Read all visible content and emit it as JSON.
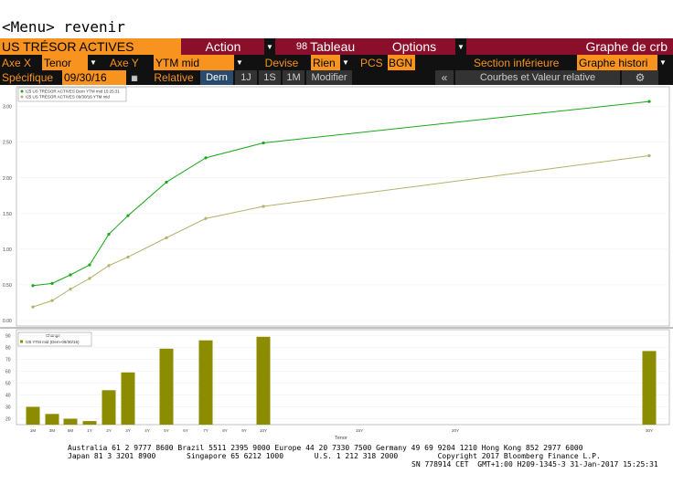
{
  "command": "<Menu> revenir",
  "toolbar": {
    "security": "US TRÉSOR ACTIVES",
    "action": "Action",
    "tableau_num": "98",
    "tableau": "Tableau",
    "options": "Options",
    "graph_title": "Graphe de crb"
  },
  "row2": {
    "axe_x_label": "Axe X",
    "axe_x_value": "Tenor",
    "axe_y_label": "Axe Y",
    "axe_y_value": "YTM mid",
    "devise_label": "Devise",
    "devise_value": "Rien",
    "pcs_label": "PCS",
    "pcs_value": "BGN",
    "section_label": "Section inférieure",
    "section_value": "Graphe histori"
  },
  "row3": {
    "specifique_label": "Spécifique",
    "date_value": "09/30/16",
    "relative_label": "Relative",
    "btn_dern": "Dern",
    "btn_1j": "1J",
    "btn_1s": "1S",
    "btn_1m": "1M",
    "btn_modifier": "Modifier",
    "collapse": "«",
    "courbes": "Courbes et Valeur relative",
    "gear": "gear-icon"
  },
  "colors": {
    "curve_current": "#1aa81a",
    "curve_past": "#b5b06a",
    "bars": "#8c8c00",
    "accent": "#f7931e",
    "toolbar_bg": "#8b0e2a"
  },
  "chart_data": [
    {
      "type": "line",
      "title": "",
      "legend": [
        "I25 US TRÉSOR ACTIVES Dern YTM mid 15:25:31",
        "I25 US TRÉSOR ACTIVES 09/30/16 YTM mid"
      ],
      "x": [
        "1M",
        "3M",
        "6M",
        "1Y",
        "2Y",
        "3Y",
        "5Y",
        "7Y",
        "10Y",
        "30Y"
      ],
      "x_years": [
        0.0833,
        0.25,
        0.5,
        1,
        2,
        3,
        5,
        7,
        10,
        30
      ],
      "series": [
        {
          "name": "I25 US TRÉSOR ACTIVES Dern YTM mid 15:25:31",
          "values": [
            0.49,
            0.52,
            0.64,
            0.78,
            1.21,
            1.47,
            1.94,
            2.28,
            2.49,
            3.07
          ]
        },
        {
          "name": "I25 US TRÉSOR ACTIVES 09/30/16 YTM mid",
          "values": [
            0.19,
            0.28,
            0.44,
            0.59,
            0.77,
            0.89,
            1.16,
            1.43,
            1.6,
            2.31
          ]
        }
      ],
      "yticks": [
        "0.00",
        "0.50",
        "1.00",
        "1.50",
        "2.00",
        "2.50",
        "3.00"
      ],
      "ylim": [
        0,
        3.2
      ]
    },
    {
      "type": "bar",
      "title": "Change",
      "legend": [
        "I25 YTM mid (Dern-09/30/16)"
      ],
      "categories": [
        "1M",
        "3M",
        "6M",
        "1Y",
        "2Y",
        "3Y",
        "5Y",
        "7Y",
        "10Y",
        "30Y"
      ],
      "values": [
        30,
        24,
        20,
        18,
        44,
        59,
        79,
        86,
        89,
        77
      ],
      "yticks": [
        "20",
        "30",
        "40",
        "50",
        "60",
        "70",
        "80",
        "90"
      ],
      "ylim": [
        15,
        95
      ],
      "xticks": [
        "1M",
        "3M",
        "6M",
        "1Y",
        "2Y",
        "3Y",
        "4Y",
        "5Y",
        "6Y",
        "7Y",
        "8Y",
        "9Y",
        "10Y",
        "15Y",
        "20Y",
        "30Y"
      ],
      "xlabel": "Tenor"
    }
  ],
  "footer": {
    "line1": "Australia 61 2 9777 8600 Brazil 5511 2395 9000 Europe 44 20 7330 7500 Germany 49 69 9204 1210 Hong Kong 852 2977 6000",
    "line2": "Japan 81 3 3201 8900       Singapore 65 6212 1000       U.S. 1 212 318 2000         Copyright 2017 Bloomberg Finance L.P.",
    "line3": "SN 778914 CET  GMT+1:00 H209-1345-3 31-Jan-2017 15:25:31"
  }
}
